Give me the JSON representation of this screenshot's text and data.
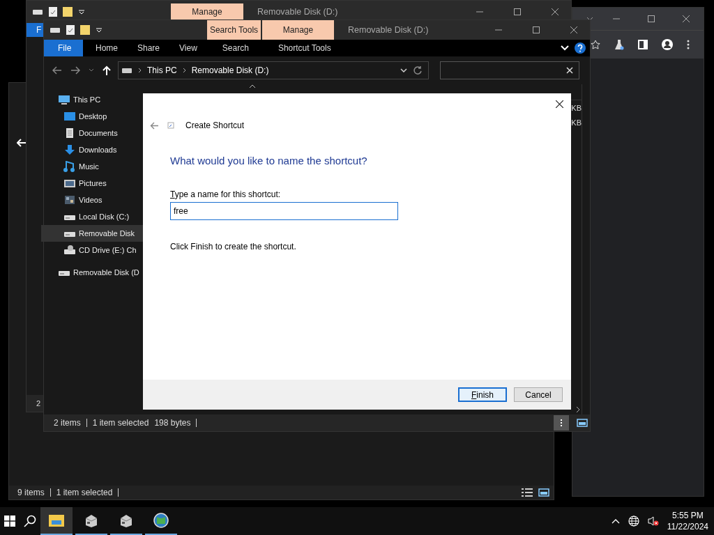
{
  "back_window": {
    "context_tab": "Manage",
    "title": "Removable Disk (D:)",
    "ribbon_tab": "F",
    "status": "2"
  },
  "lower_window": {
    "status": [
      "9 items",
      "1 item selected"
    ]
  },
  "explorer": {
    "context_tabs": [
      "Search Tools",
      "Manage"
    ],
    "title": "Removable Disk (D:)",
    "ribbon_tabs": [
      {
        "label": "File",
        "kind": "file"
      },
      {
        "label": "Home",
        "kind": "tab"
      },
      {
        "label": "Share",
        "kind": "tab"
      },
      {
        "label": "View",
        "kind": "tab"
      },
      {
        "label": "Search",
        "kind": "tab"
      },
      {
        "label": "Shortcut Tools",
        "kind": "tab"
      }
    ],
    "breadcrumb": [
      "This PC",
      "Removable Disk (D:)"
    ],
    "nav_items": [
      {
        "label": "This PC",
        "kind": "pc",
        "selected": false,
        "children": [
          {
            "label": "Desktop",
            "kind": "desktop",
            "selected": false
          },
          {
            "label": "Documents",
            "kind": "documents",
            "selected": false
          },
          {
            "label": "Downloads",
            "kind": "downloads",
            "selected": false
          },
          {
            "label": "Music",
            "kind": "music",
            "selected": false
          },
          {
            "label": "Pictures",
            "kind": "pictures",
            "selected": false
          },
          {
            "label": "Videos",
            "kind": "videos",
            "selected": false
          },
          {
            "label": "Local Disk (C:)",
            "kind": "drive",
            "selected": false
          },
          {
            "label": "Removable Disk",
            "kind": "drive",
            "selected": true
          },
          {
            "label": "CD Drive (E:) Ch",
            "kind": "cd",
            "selected": false
          }
        ]
      },
      {
        "label": "Removable Disk (D",
        "kind": "drive",
        "selected": false
      }
    ],
    "size_cells": [
      "KB",
      "KB"
    ],
    "status": [
      "2 items",
      "1 item selected",
      "198 bytes"
    ]
  },
  "dialog": {
    "title": "Create Shortcut",
    "heading": "What would you like to name the shortcut?",
    "field_label": "Type a name for this shortcut:",
    "value": "free",
    "hint": "Click Finish to create the shortcut.",
    "buttons": [
      {
        "label": "Finish",
        "kind": "default"
      },
      {
        "label": "Cancel",
        "kind": "normal"
      }
    ]
  },
  "taskbar": {
    "apps": [
      {
        "kind": "explorer",
        "selected": true
      },
      {
        "kind": "drive-app",
        "selected": false
      },
      {
        "kind": "drive-app",
        "selected": false
      },
      {
        "kind": "globe-app",
        "selected": false
      }
    ],
    "time": "5:55 PM",
    "date": "11/22/2024"
  }
}
